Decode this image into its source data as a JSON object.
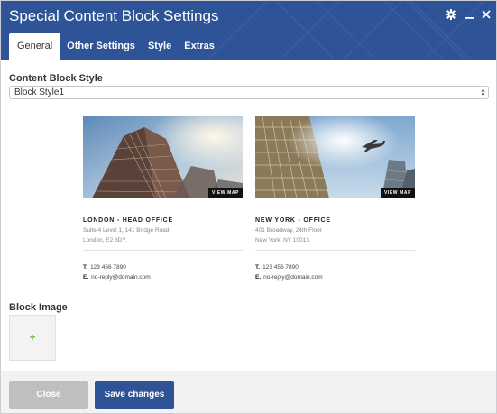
{
  "dialog": {
    "title": "Special Content Block Settings",
    "header_color": "#2e5396"
  },
  "window_controls": [
    {
      "name": "gear-icon"
    },
    {
      "name": "minimize-icon"
    },
    {
      "name": "close-icon"
    }
  ],
  "tabs": [
    {
      "label": "General",
      "active": true
    },
    {
      "label": "Other Settings",
      "active": false
    },
    {
      "label": "Style",
      "active": false
    },
    {
      "label": "Extras",
      "active": false
    }
  ],
  "content_block_style": {
    "label": "Content Block Style",
    "selected": "Block Style1"
  },
  "cards": [
    {
      "view_map": "VIEW MAP",
      "office": "LONDON - HEAD OFFICE",
      "address_line1": "Suite 4 Level 1, 141 Bridge Road",
      "address_line2": "London, E2 8DY.",
      "phone_label": "T.",
      "phone": "123 456 7890",
      "email_label": "E.",
      "email": "no-reply@domain.com"
    },
    {
      "view_map": "VIEW MAP",
      "office": "NEW YORK - OFFICE",
      "address_line1": "401 Broadway, 24th Floor",
      "address_line2": "New York, NY 10013.",
      "phone_label": "T.",
      "phone": "123 456 7890",
      "email_label": "E.",
      "email": "no-reply@domain.com"
    }
  ],
  "block_image": {
    "label": "Block Image",
    "add_icon": "plus-icon",
    "plus_symbol": "+"
  },
  "footer": {
    "close_label": "Close",
    "save_label": "Save changes"
  }
}
